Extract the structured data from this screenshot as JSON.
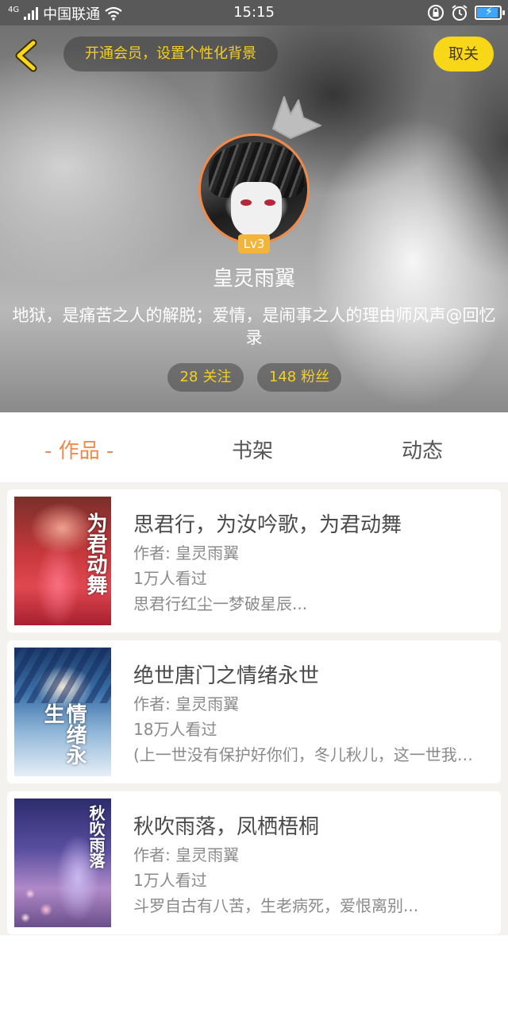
{
  "statusbar": {
    "network": "4G",
    "carrier": "中国联通",
    "time": "15:15"
  },
  "header": {
    "vip_prompt": "开通会员，设置个性化背景",
    "follow_label": "取关",
    "level": "Lv3",
    "username": "皇灵雨翼",
    "bio": "地狱，是痛苦之人的解脱；爱情，是闹事之人的理由师风声@回忆录",
    "following": {
      "count": "28",
      "label": "关注"
    },
    "fans": {
      "count": "148",
      "label": "粉丝"
    }
  },
  "tabs": [
    {
      "label": "作品",
      "active": true
    },
    {
      "label": "书架",
      "active": false
    },
    {
      "label": "动态",
      "active": false
    }
  ],
  "books": [
    {
      "title": "思君行，为汝吟歌，为君动舞",
      "author": "作者: 皇灵雨翼",
      "views": "1万人看过",
      "desc": "思君行红尘一梦破星辰...",
      "cover_text": "为君动舞"
    },
    {
      "title": "绝世唐门之情绪永世",
      "author": "作者: 皇灵雨翼",
      "views": "18万人看过",
      "desc": "(上一世没有保护好你们，冬儿秋儿，这一世我会保护好你们",
      "cover_text": "情绪永生"
    },
    {
      "title": "秋吹雨落，凤栖梧桐",
      "author": "作者: 皇灵雨翼",
      "views": "1万人看过",
      "desc": "斗罗自古有八苦，生老病死，爱恨离别...",
      "cover_text": "秋吹雨落"
    }
  ],
  "colors": {
    "accent": "#ef8a4d",
    "gold": "#f5cf23",
    "follow_button": "#f8d718"
  }
}
